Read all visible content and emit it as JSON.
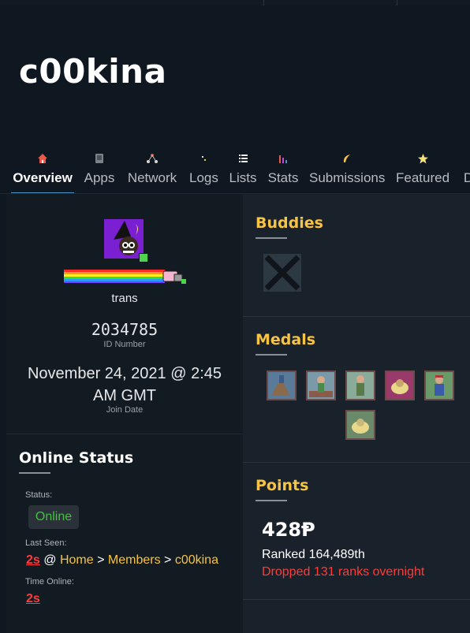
{
  "profile": {
    "username": "c00kina",
    "gender": "trans",
    "id_number": "2034785",
    "id_label": "ID Number",
    "join_date": "November 24, 2021 @ 2:45 AM GMT",
    "join_label": "Join Date"
  },
  "tabs": [
    {
      "label": "Overview",
      "icon": "home-icon",
      "active": true
    },
    {
      "label": "Apps",
      "icon": "apps-icon",
      "active": false
    },
    {
      "label": "Network",
      "icon": "network-icon",
      "active": false
    },
    {
      "label": "Logs",
      "icon": "logs-icon",
      "active": false
    },
    {
      "label": "Lists",
      "icon": "list-icon",
      "active": false
    },
    {
      "label": "Stats",
      "icon": "stats-icon",
      "active": false
    },
    {
      "label": "Submissions",
      "icon": "submissions-icon",
      "active": false
    },
    {
      "label": "Featured",
      "icon": "star-icon",
      "active": false
    },
    {
      "label": "D",
      "icon": "",
      "active": false
    }
  ],
  "online_status": {
    "title": "Online Status",
    "status_label": "Status:",
    "status_value": "Online",
    "last_seen_label": "Last Seen:",
    "last_seen_time": "2s",
    "last_seen_at": "@",
    "breadcrumb": [
      "Home",
      "Members",
      "c00kina"
    ],
    "breadcrumb_sep": ">",
    "time_online_label": "Time Online:",
    "time_online_value": "2s"
  },
  "buddies": {
    "title": "Buddies"
  },
  "medals": {
    "title": "Medals",
    "count": 6
  },
  "points": {
    "title": "Points",
    "value": "428Ᵽ",
    "ranked": "Ranked 164,489th",
    "dropped": "Dropped 131 ranks overnight"
  },
  "colors": {
    "accent_yellow": "#f6c343",
    "online_green": "#3ec43e",
    "alert_red": "#ff3b3b",
    "tab_underline": "#4a90c8"
  }
}
